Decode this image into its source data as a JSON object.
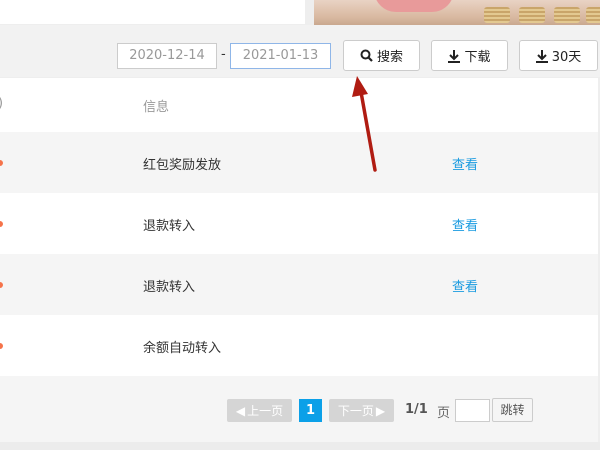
{
  "toolbar": {
    "start_date": "2020-12-14",
    "separator": "-",
    "end_date": "2021-01-13",
    "search_label": "搜索",
    "download_label": "下载",
    "days30_label": "30天"
  },
  "table": {
    "header_partial": ")",
    "header_info": "信息",
    "rows": [
      {
        "info": "红包奖励发放",
        "action": "查看"
      },
      {
        "info": "退款转入",
        "action": "查看"
      },
      {
        "info": "退款转入",
        "action": "查看"
      },
      {
        "info": "余额自动转入",
        "action": ""
      }
    ]
  },
  "pagination": {
    "prev": "上一页",
    "current": "1",
    "next": "下一页",
    "page_count": "1/1",
    "page_unit": "页",
    "jump_value": "",
    "jump_label": "跳转"
  },
  "colors": {
    "accent": "#0ba0e8",
    "link": "#1a9be0",
    "arrow": "#b01c12",
    "amount": "#f5734a"
  }
}
